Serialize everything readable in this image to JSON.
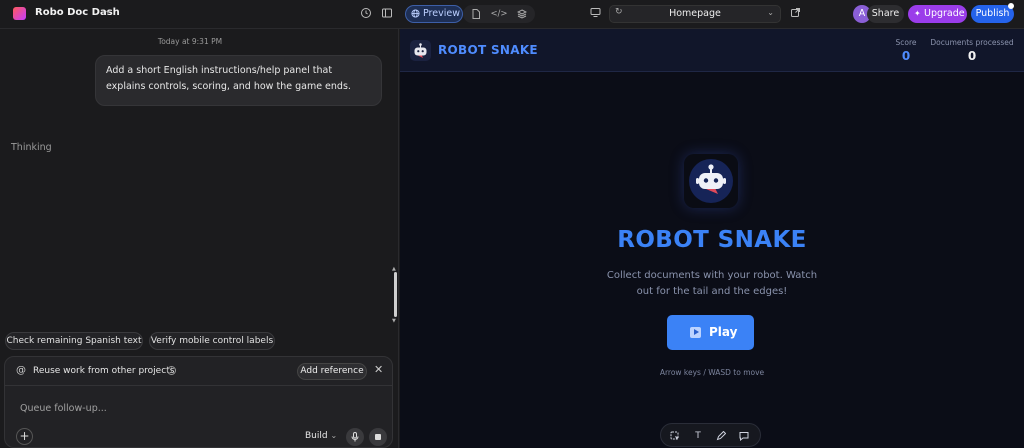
{
  "topbar": {
    "project_name": "Robo Doc Dash",
    "preview_label": "Preview",
    "route": "Homepage",
    "avatar_initial": "A",
    "share_label": "Share",
    "upgrade_label": "Upgrade",
    "publish_label": "Publish"
  },
  "chat": {
    "timestamp": "Today at 9:31 PM",
    "user_message": "Add a short English instructions/help panel that explains controls, scoring, and how the game ends.",
    "status": "Thinking",
    "suggestions": [
      "Check remaining Spanish text",
      "Verify mobile control labels"
    ],
    "reference_text": "Reuse work from other projects",
    "add_reference_label": "Add reference",
    "input_placeholder": "Queue follow-up...",
    "mode_label": "Build"
  },
  "game": {
    "title": "ROBOT SNAKE",
    "score_label": "Score",
    "score_value": "0",
    "docs_label": "Documents processed",
    "docs_value": "0",
    "hero_title": "ROBOT SNAKE",
    "description": "Collect documents with your robot. Watch out for the tail and the edges!",
    "play_label": "Play",
    "hint": "Arrow keys / WASD to move"
  },
  "colors": {
    "accent_blue": "#3b82f6",
    "upgrade_purple": "#9b3dea",
    "publish_blue": "#2563eb"
  }
}
